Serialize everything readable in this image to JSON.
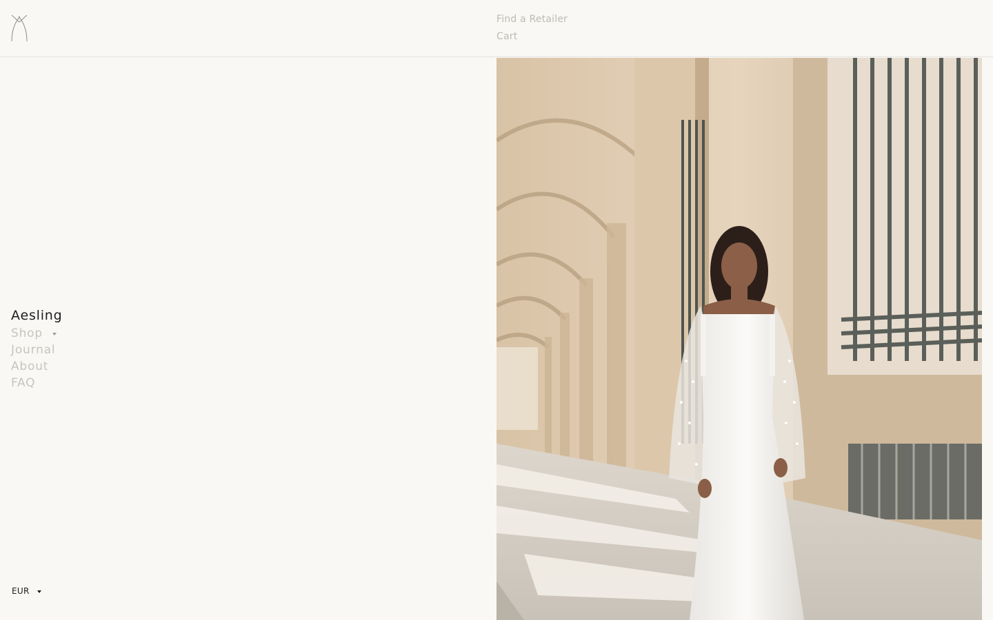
{
  "header": {
    "logo_name": "aesling-logo",
    "links": {
      "retailer": "Find a Retailer",
      "cart": "Cart"
    }
  },
  "menu": {
    "brand": "Aesling",
    "shop": "Shop",
    "journal": "Journal",
    "about": "About",
    "faq": "FAQ"
  },
  "currency": {
    "selected": "EUR"
  },
  "colors": {
    "background": "#f9f8f5",
    "text_dark": "#1c1c1c",
    "text_muted": "#c8c5c0",
    "divider": "#e3e1dc"
  },
  "hero_image": {
    "description_icon": "bride-arcade-photo"
  }
}
